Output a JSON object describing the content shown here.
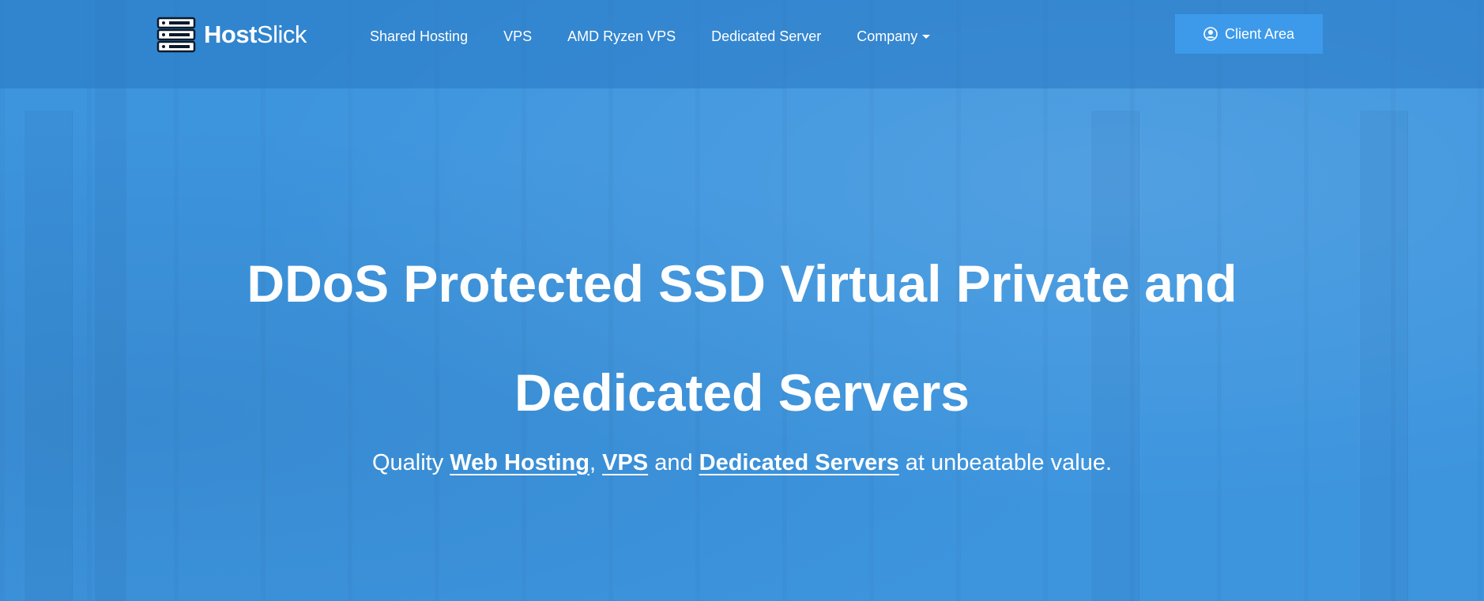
{
  "brand": {
    "name_bold": "Host",
    "name_light": "Slick",
    "icon": "server-rack-icon"
  },
  "nav": {
    "items": [
      {
        "label": "Shared Hosting"
      },
      {
        "label": "VPS"
      },
      {
        "label": "AMD Ryzen VPS"
      },
      {
        "label": "Dedicated Server"
      },
      {
        "label": "Company",
        "has_dropdown": true
      }
    ]
  },
  "client_area": {
    "label": "Client Area",
    "icon": "user-circle-icon"
  },
  "hero": {
    "title_line1": "DDoS Protected SSD Virtual Private and",
    "title_line2": "Dedicated Servers",
    "subtitle": {
      "prefix": "Quality ",
      "link1": "Web Hosting",
      "sep1": ", ",
      "link2": "VPS",
      "sep2": " and ",
      "link3": "Dedicated Servers",
      "suffix": " at unbeatable value."
    }
  },
  "colors": {
    "background": "#3d95de",
    "button": "#3d9aeb",
    "text": "#ffffff"
  }
}
